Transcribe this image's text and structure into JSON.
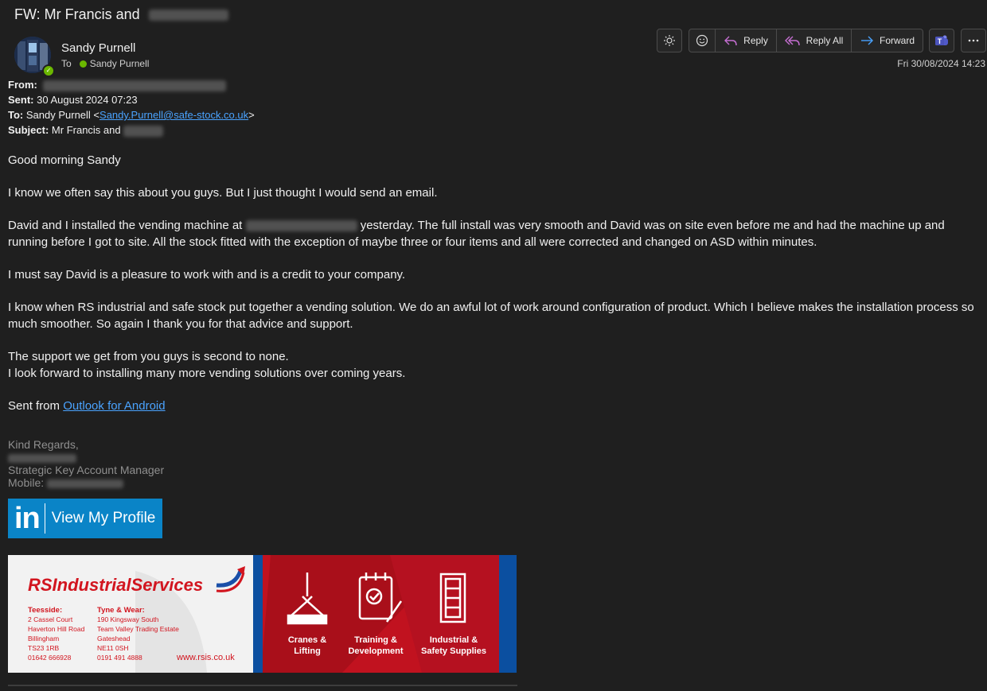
{
  "subject": {
    "prefix": "FW: Mr Francis and"
  },
  "sender": {
    "name": "Sandy Purnell",
    "to_label": "To",
    "recipient": "Sandy Purnell"
  },
  "toolbar": {
    "reply": "Reply",
    "reply_all": "Reply All",
    "forward": "Forward",
    "icons": [
      "sun-icon",
      "emoji-icon",
      "reply-icon",
      "reply-all-icon",
      "forward-icon",
      "teams-icon",
      "more-icon"
    ]
  },
  "datetime": "Fri 30/08/2024 14:23",
  "headers": {
    "from_label": "From:",
    "sent_label": "Sent:",
    "sent_value": "30 August 2024 07:23",
    "to_label": "To:",
    "to_name": "Sandy Purnell <",
    "to_email": "Sandy.Purnell@safe-stock.co.uk",
    "to_close": ">",
    "subject_label": "Subject:",
    "subject_value": "Mr Francis and"
  },
  "body": {
    "greeting": "Good morning Sandy",
    "p1": "I know we often say this about you guys. But I just thought I would send an email.",
    "p2_start": "David and I installed the vending machine at",
    "p2_end": "yesterday. The full install was very smooth and David was on site even before me and had the machine up and running before I got to site. All the stock fitted with the exception of maybe three or four items and all were corrected and changed on ASD within minutes.",
    "p3": "I must say David is a pleasure to work with and is a credit to your company.",
    "p4": "I know when RS industrial and safe stock put together a vending solution. We do an awful lot of work around configuration of product. Which I believe makes the installation process so much smoother. So again I thank you for that advice and support.",
    "p5a": "The support we get from you guys is second to none.",
    "p5b": "I look forward to installing many more vending solutions over coming years.",
    "sent_from": "Sent from",
    "sent_from_link": "Outlook for Android"
  },
  "signature": {
    "regards": "Kind Regards,",
    "title": "Strategic Key Account Manager",
    "mobile_label": "Mobile:"
  },
  "linkedin": {
    "logo": "in",
    "label": "View My Profile"
  },
  "banner": {
    "brand": "RSIndustrialServices",
    "teesside_title": "Teesside:",
    "teesside_lines": [
      "2 Cassel Court",
      "Haverton Hill Road",
      "Billingham",
      "TS23 1RB",
      "01642 666928"
    ],
    "tyne_title": "Tyne & Wear:",
    "tyne_lines": [
      "190 Kingsway South",
      "Team Valley Trading Estate",
      "Gateshead",
      "NE11 0SH",
      "0191 491 4888"
    ],
    "website": "www.rsis.co.uk",
    "services": [
      {
        "line1": "Cranes &",
        "line2": "Lifting"
      },
      {
        "line1": "Training &",
        "line2": "Development"
      },
      {
        "line1": "Industrial &",
        "line2": "Safety Supplies"
      }
    ]
  },
  "colors": {
    "background": "#1f1f1f",
    "link": "#4aa3ff",
    "presence": "#6bb700",
    "linkedin": "#0a84c7",
    "banner_red": "#c1121f",
    "banner_blue": "#0b4fa0"
  }
}
